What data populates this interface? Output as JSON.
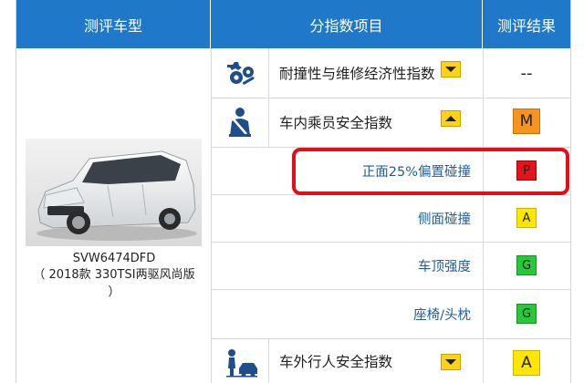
{
  "header": {
    "col_model": "测评车型",
    "col_items": "分指数项目",
    "col_result": "测评结果"
  },
  "vehicle": {
    "model_code": "SVW6474DFD",
    "model_desc_line1": "（ 2018款 330TSI两驱风尚版",
    "model_desc_line2": "）"
  },
  "rows": {
    "durability": {
      "label": "耐撞性与维修经济性指数",
      "icon": "wrench-gears-icon",
      "result": "--"
    },
    "occupant": {
      "label": "车内乘员安全指数",
      "icon": "seatbelt-occupant-icon",
      "result": "M",
      "result_color": "#f7941d"
    },
    "offset25": {
      "label": "正面25%偏置碰撞",
      "result": "P",
      "result_color": "#e3151b"
    },
    "side": {
      "label": "侧面碰撞",
      "result": "A",
      "result_color": "#ffe600"
    },
    "roof": {
      "label": "车顶强度",
      "result": "G",
      "result_color": "#28c936"
    },
    "seat": {
      "label": "座椅/头枕",
      "result": "G",
      "result_color": "#28c936"
    },
    "pedestrian": {
      "label": "车外行人安全指数",
      "icon": "pedestrian-car-icon",
      "result": "A",
      "result_color": "#ffe600"
    }
  },
  "colors": {
    "header_bg": "#1f78c8",
    "dropdown": "#ffd21a",
    "highlight": "#e0101a",
    "sub_text": "#1f5e9a"
  }
}
